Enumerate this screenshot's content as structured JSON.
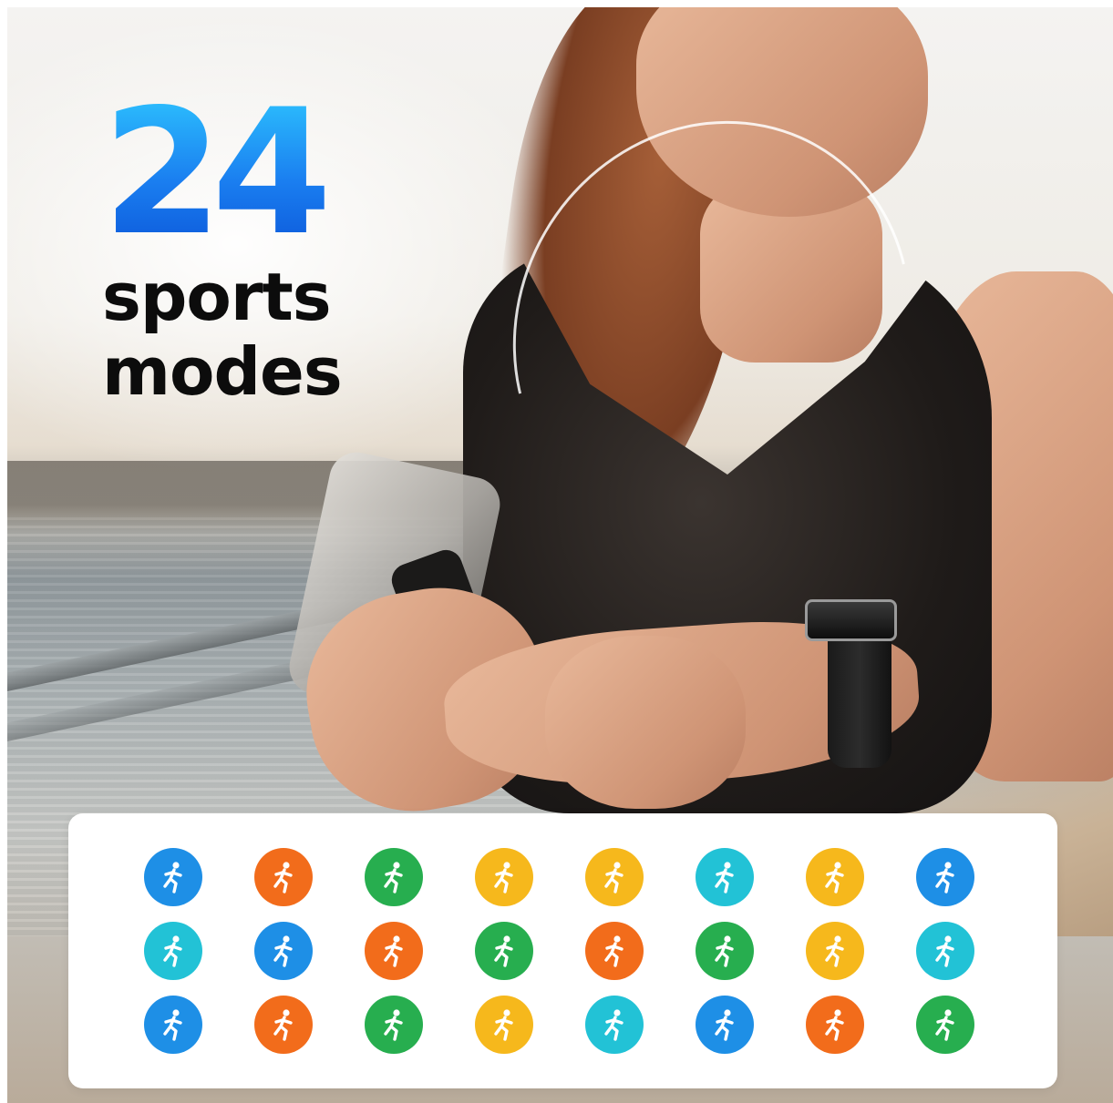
{
  "headline": {
    "number": "24",
    "line1": "sports",
    "line2": "modes"
  },
  "colors": {
    "number_gradient": [
      "#2ec6ff",
      "#0b55d8"
    ],
    "panel_background": "#ffffff"
  },
  "sport_icons": [
    {
      "name": "running-icon",
      "color": "#1e8fe6"
    },
    {
      "name": "cycling-icon",
      "color": "#f26c1b"
    },
    {
      "name": "swimming-icon",
      "color": "#27ae4f"
    },
    {
      "name": "jump-rope-icon",
      "color": "#f6b81c"
    },
    {
      "name": "walking-icon",
      "color": "#f6b81c"
    },
    {
      "name": "volleyball-icon",
      "color": "#22c2d6"
    },
    {
      "name": "football-icon",
      "color": "#f6b81c"
    },
    {
      "name": "baseball-icon",
      "color": "#1e8fe6"
    },
    {
      "name": "badminton-icon",
      "color": "#22c2d6"
    },
    {
      "name": "table-tennis-icon",
      "color": "#1e8fe6"
    },
    {
      "name": "tennis-icon",
      "color": "#f26c1b"
    },
    {
      "name": "hiking-icon",
      "color": "#27ae4f"
    },
    {
      "name": "pickleball-icon",
      "color": "#f26c1b"
    },
    {
      "name": "handball-icon",
      "color": "#27ae4f"
    },
    {
      "name": "skiing-icon",
      "color": "#f6b81c"
    },
    {
      "name": "basketball-icon",
      "color": "#22c2d6"
    },
    {
      "name": "yoga-icon",
      "color": "#1e8fe6"
    },
    {
      "name": "meditation-icon",
      "color": "#f26c1b"
    },
    {
      "name": "spinning-bike-icon",
      "color": "#27ae4f"
    },
    {
      "name": "sit-up-icon",
      "color": "#f6b81c"
    },
    {
      "name": "climbing-icon",
      "color": "#22c2d6"
    },
    {
      "name": "rowing-icon",
      "color": "#1e8fe6"
    },
    {
      "name": "gymnastics-icon",
      "color": "#f26c1b"
    },
    {
      "name": "jumping-jacks-icon",
      "color": "#27ae4f"
    }
  ]
}
